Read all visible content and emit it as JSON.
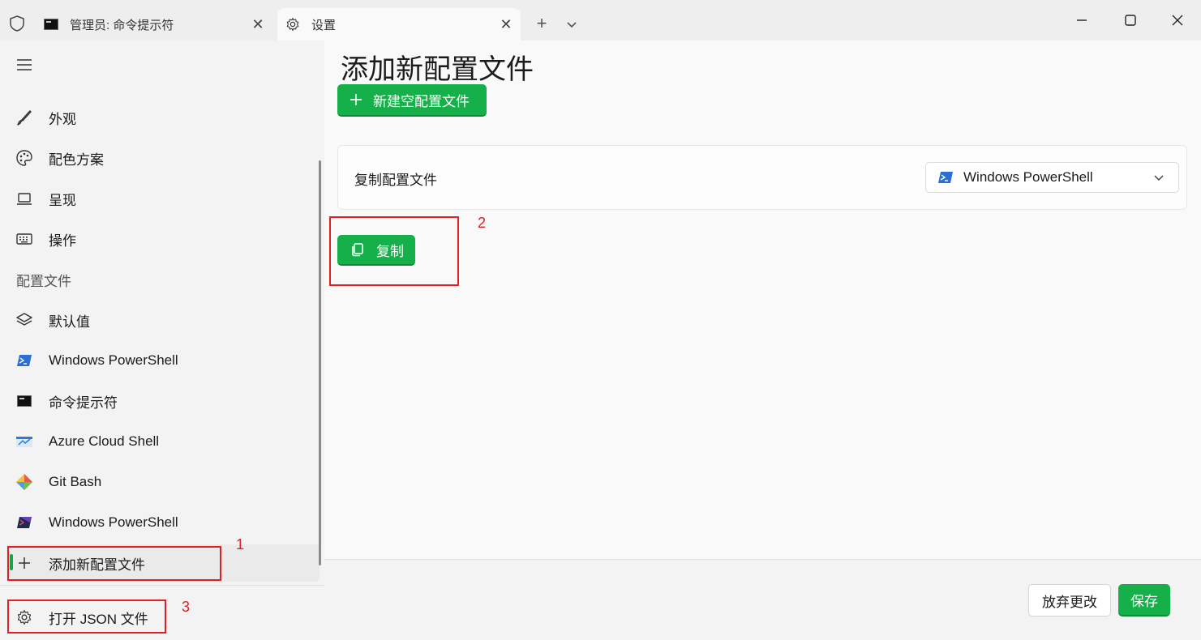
{
  "titlebar": {
    "inactive_tab_title": "管理员: 命令提示符",
    "active_tab_title": "设置",
    "new_tab": "+",
    "close": "✕"
  },
  "sidebar": {
    "items": [
      {
        "label": "外观",
        "icon": "brush-icon"
      },
      {
        "label": "配色方案",
        "icon": "palette-icon"
      },
      {
        "label": "呈现",
        "icon": "laptop-icon"
      },
      {
        "label": "操作",
        "icon": "keyboard-icon"
      }
    ],
    "section_label": "配置文件",
    "profiles": [
      {
        "label": "默认值",
        "icon": "layers-icon"
      },
      {
        "label": "Windows PowerShell",
        "icon": "powershell-icon"
      },
      {
        "label": "命令提示符",
        "icon": "cmd-icon"
      },
      {
        "label": "Azure Cloud Shell",
        "icon": "azure-icon"
      },
      {
        "label": "Git Bash",
        "icon": "git-icon"
      },
      {
        "label": "Windows PowerShell",
        "icon": "powershell-dark-icon"
      }
    ],
    "add_profile_label": "添加新配置文件",
    "open_json_label": "打开 JSON 文件"
  },
  "main": {
    "title": "添加新配置文件",
    "new_empty_button": "新建空配置文件",
    "duplicate_label": "复制配置文件",
    "duplicate_selected": "Windows PowerShell",
    "copy_button": "复制"
  },
  "footer": {
    "discard_button": "放弃更改",
    "save_button": "保存"
  },
  "annotations": [
    "1",
    "2",
    "3"
  ],
  "colors": {
    "accent": "#16b04a",
    "annotation": "#e02020"
  }
}
